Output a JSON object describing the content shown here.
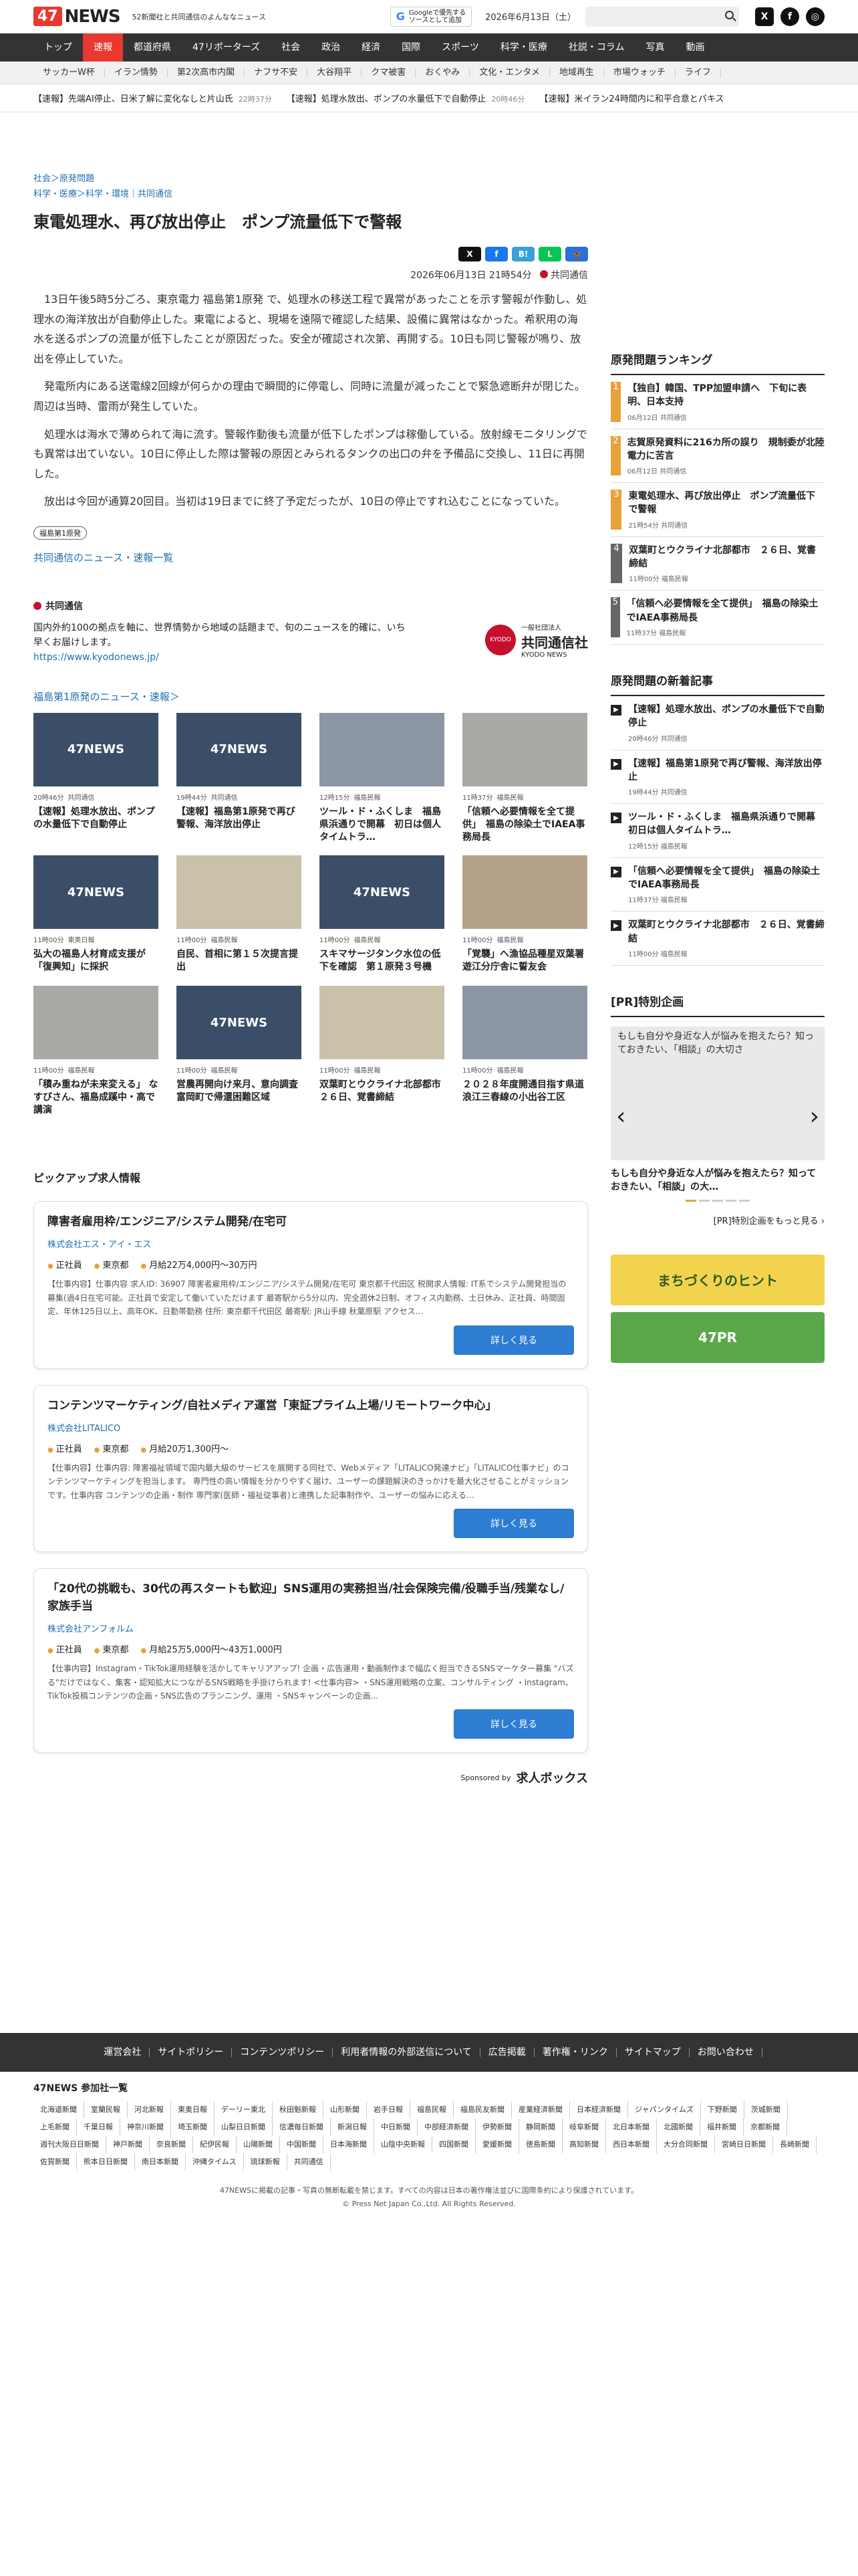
{
  "header": {
    "logo_num": "47",
    "logo_text": "NEWS",
    "tagline": "52新聞社と共同通信のよんななニュース",
    "google_line1": "Googleで優先する",
    "google_line2": "ソースとして追加",
    "date": "2026年6月13日（土）"
  },
  "nav": [
    "トップ",
    "速報",
    "都道府県",
    "47リポーターズ",
    "社会",
    "政治",
    "経済",
    "国際",
    "スポーツ",
    "科学・医療",
    "社説・コラム",
    "写真",
    "動画"
  ],
  "subnav": [
    "サッカーW杯",
    "イラン情勢",
    "第2次高市内閣",
    "ナフサ不安",
    "大谷翔平",
    "クマ被害",
    "おくやみ",
    "文化・エンタメ",
    "地域再生",
    "市場ウォッチ",
    "ライフ"
  ],
  "ticker": [
    {
      "text": "【速報】先端AI停止、日米了解に変化なしと片山氏",
      "time": "22時37分"
    },
    {
      "text": "【速報】処理水放出、ポンプの水量低下で自動停止",
      "time": "20時46分"
    },
    {
      "text": "【速報】米イラン24時間内に和平合意とパキス",
      "time": ""
    }
  ],
  "article": {
    "crumb1": "社会＞原発問題",
    "crumb2": "科学・医療＞科学・環境｜共同通信",
    "title": "東電処理水、再び放出停止　ポンプ流量低下で警報",
    "datetime": "2026年06月13日 21時54分",
    "source": "共同通信",
    "paragraphs": [
      "13日午後5時5分ごろ、東京電力 福島第1原発 で、処理水の移送工程で異常があったことを示す警報が作動し、処理水の海洋放出が自動停止した。東電によると、現場を遠隔で確認した結果、設備に異常はなかった。希釈用の海水を送るポンプの流量が低下したことが原因だった。安全が確認され次第、再開する。10日も同じ警報が鳴り、放出を停止していた。",
      "発電所内にある送電線2回線が何らかの理由で瞬間的に停電し、同時に流量が減ったことで緊急遮断弁が閉じた。周辺は当時、雷雨が発生していた。",
      "処理水は海水で薄められて海に流す。警報作動後も流量が低下したポンプは稼働している。放射線モニタリングでも異常は出ていない。10日に停止した際は警報の原因とみられるタンクの出口の弁を予備品に交換し、11日に再開した。",
      "放出は今回が通算20回目。当初は19日までに終了予定だったが、10日の停止ですれ込むことになっていた。"
    ],
    "tag": "福島第1原発",
    "more_link": "共同通信のニュース・速報一覧"
  },
  "source_box": {
    "name": "共同通信",
    "desc": "国内外約100の拠点を軸に、世界情勢から地域の話題まで、旬のニュースを的確に、いち早くお届けします。",
    "url": "https://www.kyodonews.jp/",
    "logo_small": "一般社団法人",
    "logo_name": "共同通信社",
    "logo_en": "KYODO NEWS"
  },
  "related_heading": "福島第1原発のニュース・速報＞",
  "related": [
    {
      "img": "47NEWS",
      "style": "",
      "time": "20時46分",
      "src": "共同通信",
      "title": "【速報】処理水放出、ポンプの水量低下で自動停止"
    },
    {
      "img": "47NEWS",
      "style": "",
      "time": "19時44分",
      "src": "共同通信",
      "title": "【速報】福島第1原発で再び警報、海洋放出停止"
    },
    {
      "img": "",
      "style": "photo2",
      "time": "12時15分",
      "src": "福島民報",
      "title": "ツール・ド・ふくしま　福島県浜通りで開幕　初日は個人タイムトラ…"
    },
    {
      "img": "",
      "style": "photo",
      "time": "11時37分",
      "src": "福島民報",
      "title": "「信頼へ必要情報を全て提供」　福島の除染土でIAEA事務局長"
    },
    {
      "img": "47NEWS",
      "style": "",
      "time": "11時00分",
      "src": "東奥日報",
      "title": "弘大の福島人材育成支援が「復興知」に採択"
    },
    {
      "img": "",
      "style": "photo3",
      "time": "11時00分",
      "src": "福島民報",
      "title": "自民、首相に第１５次提言提出"
    },
    {
      "img": "47NEWS",
      "style": "",
      "time": "11時00分",
      "src": "福島民報",
      "title": "スキマサージタンク水位の低下を確認　第１原発３号機"
    },
    {
      "img": "",
      "style": "photo4",
      "time": "11時00分",
      "src": "福島民報",
      "title": "「覚襲」へ漁協品種星双葉署遊江分庁舎に誓友会"
    },
    {
      "img": "",
      "style": "photo",
      "time": "11時00分",
      "src": "福島民報",
      "title": "「積み重ねが未来変える」 なすびさん、福島成蹊中・高で講演"
    },
    {
      "img": "47NEWS",
      "style": "",
      "time": "11時00分",
      "src": "福島民報",
      "title": "営農再開向け来月、意向調査　富岡町で帰還困難区域"
    },
    {
      "img": "",
      "style": "photo3",
      "time": "11時00分",
      "src": "福島民報",
      "title": "双葉町とウクライナ北部都市　２６日、覚書締結"
    },
    {
      "img": "",
      "style": "photo2",
      "time": "11時00分",
      "src": "福島民報",
      "title": "２０２８年度開通目指す県道浪江三春線の小出谷工区"
    }
  ],
  "jobs_heading": "ピックアップ求人情報",
  "jobs": [
    {
      "title": "障害者雇用枠/エンジニア/システム開発/在宅可",
      "company": "株式会社エス・アイ・エス",
      "type": "正社員",
      "place": "東京都",
      "pay": "月給22万4,000円〜30万円",
      "desc": "【仕事内容】仕事内容 求人ID: 36907 障害者雇用枠/エンジニア/システム開発/在宅可 東京都千代田区 税開求人情報: IT系でシステム開発担当の募集(過4日在宅可能。正社員で安定して働いていただけます 最寄駅から5分以内、完全週休2日制、オフィス内勤務、土日休み、正社員、時間固定、年休125日以上、高年OK、日勤帯勤務 住所: 東京都千代田区 最寄駅: JR山手線 秋葉原駅 アクセス..."
    },
    {
      "title": "コンテンツマーケティング/自社メディア運営「東証プライム上場/リモートワーク中心」",
      "company": "株式会社LITALICO",
      "type": "正社員",
      "place": "東京都",
      "pay": "月給20万1,300円〜",
      "desc": "【仕事内容】仕事内容: 障害福祉領域で国内最大級のサービスを展開する同社で、Webメディア「LITALICO発達ナビ」「LITALICO仕事ナビ」のコンテンツマーケティングを担当します。 専門性の高い情報を分かりやすく届け、ユーザーの課題解決のきっかけを最大化させることがミッションです。仕事内容 コンテンツの企画・制作 専門家(医師・福祉従事者)と連携した記事制作や、ユーザーの悩みに応える..."
    },
    {
      "title": "「20代の挑戦も、30代の再スタートも歓迎」SNS運用の実務担当/社会保険完備/役職手当/残業なし/家族手当",
      "company": "株式会社アンフォルム",
      "type": "正社員",
      "place": "東京都",
      "pay": "月給25万5,000円〜43万1,000円",
      "desc": "【仕事内容】Instagram・TikTok運用経験を活かしてキャリアアップ! 企画・広告運用・動画制作まで幅広く担当できるSNSマーケター募集 \"バズる\"だけではなく、集客・認知拡大につながるSNS戦略を手掛けられます! <仕事内容> ・SNS運用戦略の立案、コンサルティング ・Instagram、TikTok投稿コンテンツの企画・SNS広告のプランニング、運用 ・SNSキャンペーンの企画..."
    }
  ],
  "job_button": "詳しく見る",
  "sponsor": {
    "label": "Sponsored by",
    "name": "求人ボックス"
  },
  "sidebar": {
    "ranking_title": "原発問題ランキング",
    "ranking": [
      {
        "no": "1",
        "title": "【独自】韓国、TPP加盟申請へ　下旬に表明、日本支持",
        "time": "06月12日",
        "src": "共同通信"
      },
      {
        "no": "2",
        "title": "志賀原発資料に216カ所の誤り　規制委が北陸電力に苦言",
        "time": "06月12日",
        "src": "共同通信"
      },
      {
        "no": "3",
        "title": "東電処理水、再び放出停止　ポンプ流量低下で警報",
        "time": "21時54分",
        "src": "共同通信"
      },
      {
        "no": "4",
        "title": "双葉町とウクライナ北部都市　２６日、覚書締結",
        "time": "11時00分",
        "src": "福島民報"
      },
      {
        "no": "5",
        "title": "「信頼へ必要情報を全て提供」　福島の除染土でIAEA事務局長",
        "time": "11時37分",
        "src": "福島民報"
      }
    ],
    "latest_title": "原発問題の新着記事",
    "latest": [
      {
        "title": "【速報】処理水放出、ポンプの水量低下で自動停止",
        "time": "20時46分",
        "src": "共同通信"
      },
      {
        "title": "【速報】福島第1原発で再び警報、海洋放出停止",
        "time": "19時44分",
        "src": "共同通信"
      },
      {
        "title": "ツール・ド・ふくしま　福島県浜通りで開幕　初日は個人タイムトラ…",
        "time": "12時15分",
        "src": "福島民報"
      },
      {
        "title": "「信頼へ必要情報を全て提供」　福島の除染土でIAEA事務局長",
        "time": "11時37分",
        "src": "福島民報"
      },
      {
        "title": "双葉町とウクライナ北部都市　２６日、覚書締結",
        "time": "11時00分",
        "src": "福島民報"
      }
    ],
    "pr_title": "[PR]特別企画",
    "pr_alt": "もしも自分や身近な人が悩みを抱えたら？知っておきたい、「相談」の大切さ",
    "pr_caption": "もしも自分や身近な人が悩みを抱えたら？知っておきたい、「相談」の大…",
    "pr_more": "[PR]特別企画をもっと見る ›",
    "banner1": "まちづくりのヒント",
    "banner2": "47PR"
  },
  "footer": {
    "links": [
      "運営会社",
      "サイトポリシー",
      "コンテンツポリシー",
      "利用者情報の外部送信について",
      "広告掲載",
      "著作権・リンク",
      "サイトマップ",
      "お問い合わせ"
    ],
    "members_title": "47NEWS 参加社一覧",
    "members": [
      "北海道新聞",
      "室蘭民報",
      "河北新報",
      "東奥日報",
      "デーリー東北",
      "秋田魁新報",
      "山形新聞",
      "岩手日報",
      "福島民報",
      "福島民友新聞",
      "産業経済新聞",
      "日本経済新聞",
      "ジャパンタイムズ",
      "下野新聞",
      "茨城新聞",
      "上毛新聞",
      "千葉日報",
      "神奈川新聞",
      "埼玉新聞",
      "山梨日日新聞",
      "信濃毎日新聞",
      "新潟日報",
      "中日新聞",
      "中部経済新聞",
      "伊勢新聞",
      "静岡新聞",
      "岐阜新聞",
      "北日本新聞",
      "北國新聞",
      "福井新聞",
      "京都新聞",
      "週刊大阪日日新聞",
      "神戸新聞",
      "奈良新聞",
      "紀伊民報",
      "山陽新聞",
      "中国新聞",
      "日本海新聞",
      "山陰中央新報",
      "四国新聞",
      "愛媛新聞",
      "徳島新聞",
      "高知新聞",
      "西日本新聞",
      "大分合同新聞",
      "宮崎日日新聞",
      "長崎新聞",
      "佐賀新聞",
      "熊本日日新聞",
      "南日本新聞",
      "沖縄タイムス",
      "琉球新報",
      "共同通信"
    ],
    "copy1": "47NEWSに掲載の記事・写真の無断転載を禁じます。すべての内容は日本の著作権法並びに国際条約により保護されています。",
    "copy2": "© Press Net Japan Co.,Ltd. All Rights Reserved."
  }
}
